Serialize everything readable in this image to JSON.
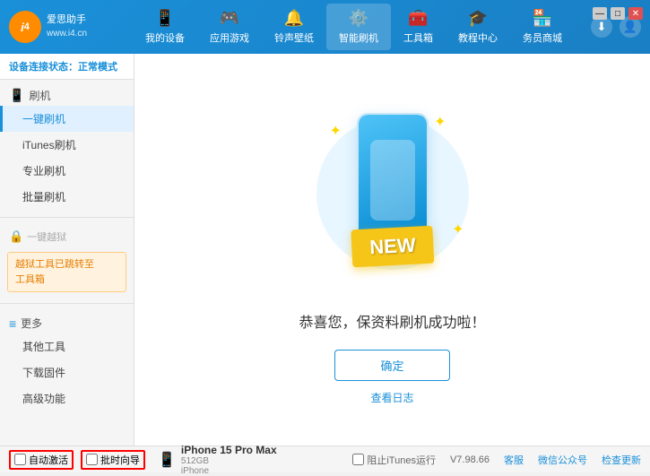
{
  "header": {
    "logo_text_line1": "爱思助手",
    "logo_text_line2": "www.i4.cn",
    "logo_letter": "i4",
    "nav": [
      {
        "id": "my-device",
        "icon": "📱",
        "label": "我的设备",
        "active": false
      },
      {
        "id": "app-games",
        "icon": "👤",
        "label": "应用游戏",
        "active": false
      },
      {
        "id": "ringtone",
        "icon": "🔔",
        "label": "铃声壁纸",
        "active": false
      },
      {
        "id": "smart-flash",
        "icon": "⚙️",
        "label": "智能刷机",
        "active": true
      },
      {
        "id": "toolbox",
        "icon": "🧰",
        "label": "工具箱",
        "active": false
      },
      {
        "id": "tutorial",
        "icon": "🎓",
        "label": "教程中心",
        "active": false
      },
      {
        "id": "service",
        "icon": "🏪",
        "label": "务员商城",
        "active": false
      }
    ],
    "download_icon": "⬇",
    "user_icon": "👤"
  },
  "sidebar": {
    "status_label": "设备连接状态：",
    "status_value": "正常模式",
    "sections": [
      {
        "id": "flash",
        "icon": "📱",
        "label": "刷机",
        "items": [
          {
            "id": "one-click",
            "label": "一键刷机",
            "active": true
          },
          {
            "id": "itunes-flash",
            "label": "iTunes刷机",
            "active": false
          },
          {
            "id": "pro-flash",
            "label": "专业刷机",
            "active": false
          },
          {
            "id": "batch-flash",
            "label": "批量刷机",
            "active": false
          }
        ]
      },
      {
        "id": "one-jailbreak",
        "icon": "🔒",
        "label": "一键越狱",
        "disabled": true,
        "warning": "越狱工具已跳转至\n工具箱"
      },
      {
        "id": "more",
        "icon": "≡",
        "label": "更多",
        "items": [
          {
            "id": "other-tools",
            "label": "其他工具"
          },
          {
            "id": "download-firmware",
            "label": "下载固件"
          },
          {
            "id": "advanced",
            "label": "高级功能"
          }
        ]
      }
    ],
    "checkbox_labels": {
      "auto_activate": "自动激活",
      "time_guided": "批时向导"
    }
  },
  "content": {
    "new_badge": "NEW",
    "success_message": "恭喜您，保资料刷机成功啦！",
    "confirm_button": "确定",
    "log_link": "查看日志"
  },
  "device": {
    "name": "iPhone 15 Pro Max",
    "storage": "512GB",
    "type": "iPhone"
  },
  "footer": {
    "version": "V7.98.66",
    "links": [
      "客服",
      "微信公众号",
      "检查更新"
    ],
    "itunes_check": "阻止iTunes运行"
  }
}
